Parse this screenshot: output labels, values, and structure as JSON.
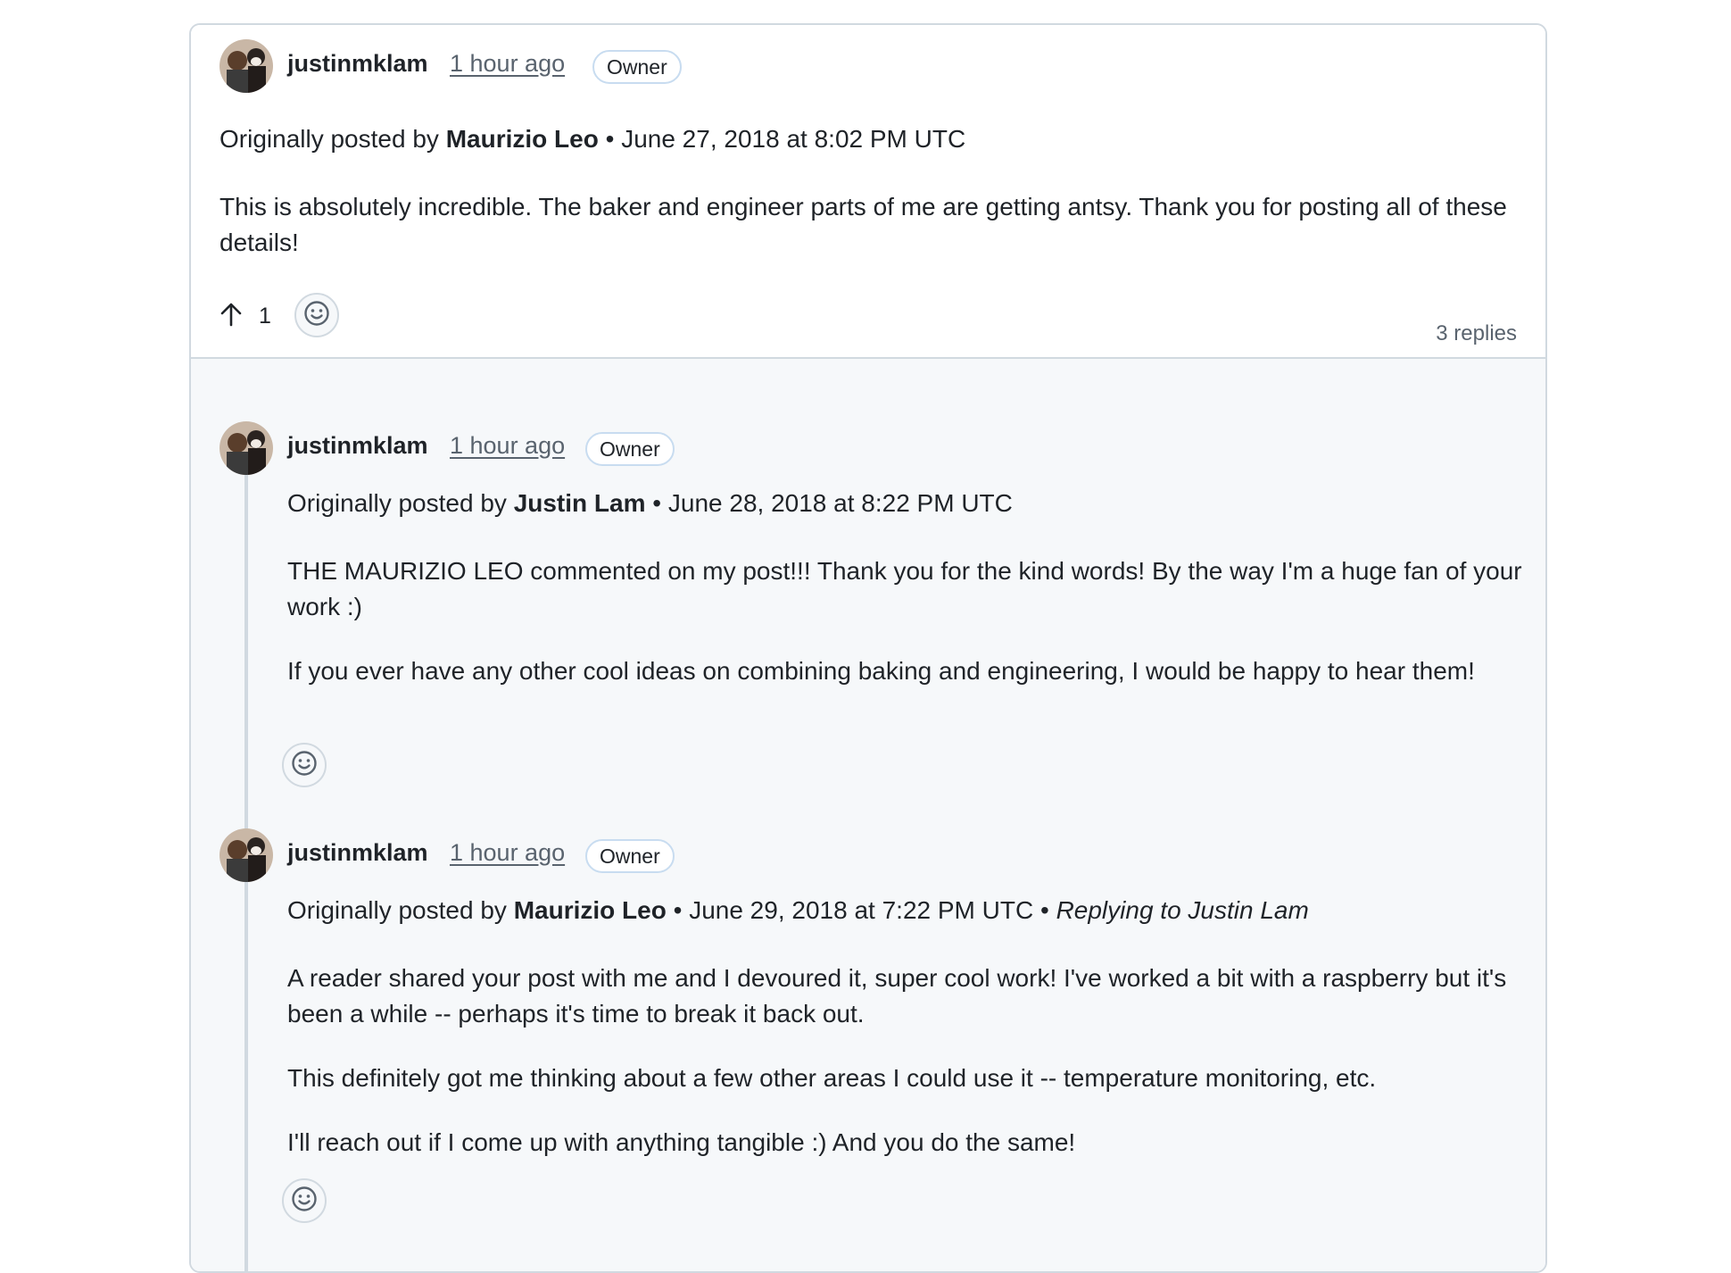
{
  "top": {
    "author": "justinmklam",
    "time": "1 hour ago",
    "badge": "Owner",
    "posted_prefix": "Originally posted by",
    "posted_author": "Maurizio Leo",
    "posted_date": "June 27, 2018 at 8:02 PM UTC",
    "body": "This is absolutely incredible. The baker and engineer parts of me are getting antsy. Thank you for posting all of these details!",
    "upvotes": "1",
    "replies_label": "3 replies"
  },
  "replies": [
    {
      "author": "justinmklam",
      "time": "1 hour ago",
      "badge": "Owner",
      "posted_prefix": "Originally posted by",
      "posted_author": "Justin Lam",
      "posted_date": "June 28, 2018 at 8:22 PM UTC",
      "paragraphs": [
        "THE MAURIZIO LEO commented on my post!!! Thank you for the kind words! By the way I'm a huge fan of your work :)",
        "If you ever have any other cool ideas on combining baking and engineering, I would be happy to hear them!"
      ]
    },
    {
      "author": "justinmklam",
      "time": "1 hour ago",
      "badge": "Owner",
      "posted_prefix": "Originally posted by",
      "posted_author": "Maurizio Leo",
      "posted_date": "June 29, 2018 at 7:22 PM UTC",
      "replying_to": "Replying to Justin Lam",
      "paragraphs": [
        "A reader shared your post with me and I devoured it, super cool work! I've worked a bit with a raspberry but it's been a while -- perhaps it's time to break it back out.",
        "This definitely got me thinking about a few other areas I could use it -- temperature monitoring, etc.",
        "I'll reach out if I come up with anything tangible :) And you do the same!"
      ]
    }
  ],
  "icons": {
    "upvote": "arrow-up-icon",
    "reaction": "smiley-icon",
    "avatar": "user-avatar"
  },
  "colors": {
    "border": "#d1d9e0",
    "reply_bg": "#f6f8fa",
    "muted": "#59636e",
    "badge_border": "#c8dcf0"
  }
}
